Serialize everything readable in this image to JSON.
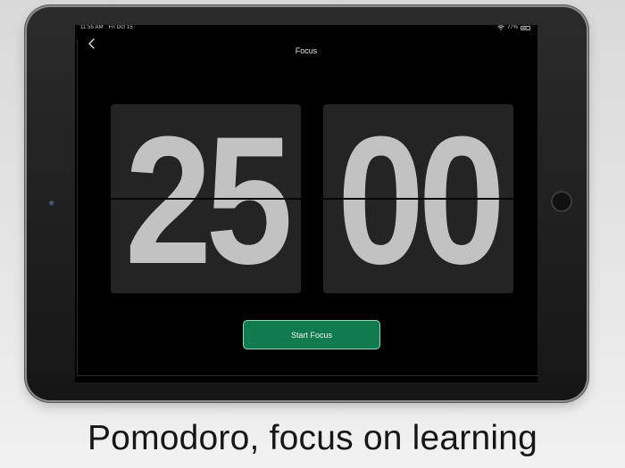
{
  "status_bar": {
    "time": "11:55 AM",
    "date": "Fri Oct 15",
    "battery_text": "77%",
    "battery_level": 0.77
  },
  "nav": {
    "title": "Focus",
    "back_icon": "chevron-left-icon",
    "settings_icon": "sliders-icon"
  },
  "timer": {
    "minutes": "25",
    "seconds": "00"
  },
  "start_button": {
    "label": "Start Focus"
  },
  "caption": {
    "text": "Pomodoro, focus on learning"
  },
  "colors": {
    "accent": "#117a4f",
    "digit": "#c2c2c2",
    "card": "#242424"
  }
}
